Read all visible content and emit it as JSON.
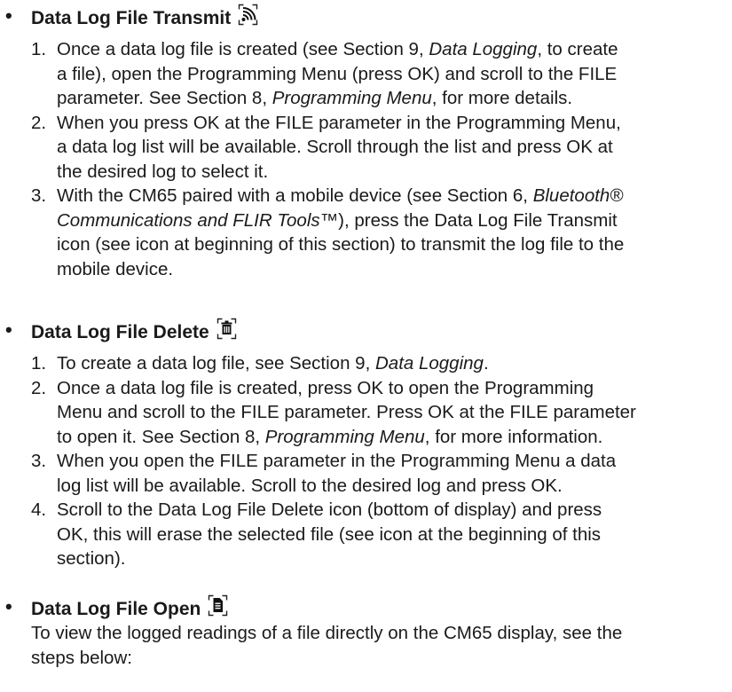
{
  "sections": [
    {
      "title": "Data Log File Transmit",
      "icon": "wireless-transmit-icon",
      "steps": [
        [
          "Once a data log file is created (see Section 9, ",
          {
            "i": "Data Logging"
          },
          ", to create",
          "\n",
          "a file), open the Programming Menu (press OK) and scroll to the FILE",
          "\n",
          "parameter. See Section 8, ",
          {
            "i": "Programming Menu"
          },
          ", for more details."
        ],
        [
          "When you press OK at the FILE parameter in the Programming Menu,",
          "\n",
          "a data log list will be available. Scroll through the list and press OK at",
          "\n",
          "the desired log to select it."
        ],
        [
          "With the CM65 paired with a mobile device (see Section 6, ",
          {
            "i": "Bluetooth®"
          },
          "\n",
          {
            "i": "Communications and FLIR Tools™"
          },
          "), press the Data Log File Transmit",
          "\n",
          "icon (see icon at beginning of this section) to transmit the log file to the",
          "\n",
          "mobile device."
        ]
      ]
    },
    {
      "title": "Data Log File Delete",
      "icon": "trash-icon",
      "steps": [
        [
          "To create a data log file, see Section 9, ",
          {
            "i": "Data Logging"
          },
          "."
        ],
        [
          "Once a data log file is created, press OK to open the Programming",
          "\n",
          "Menu and scroll to the FILE parameter. Press OK at the FILE parameter",
          "\n",
          "to open it. See Section 8, ",
          {
            "i": "Programming Menu"
          },
          ", for more information."
        ],
        [
          "When you open the FILE parameter in the Programming Menu a data",
          "\n",
          "log list will be available. Scroll to the desired log and press OK."
        ],
        [
          "Scroll to the Data Log File Delete icon (bottom of display) and press",
          "\n",
          "OK, this will erase the selected file (see icon at the beginning of this",
          "\n",
          "section)."
        ]
      ]
    },
    {
      "title": "Data Log File Open",
      "icon": "file-open-icon",
      "intro": "To view the logged readings of a file directly on the CM65 display, see the\nsteps below:"
    }
  ]
}
